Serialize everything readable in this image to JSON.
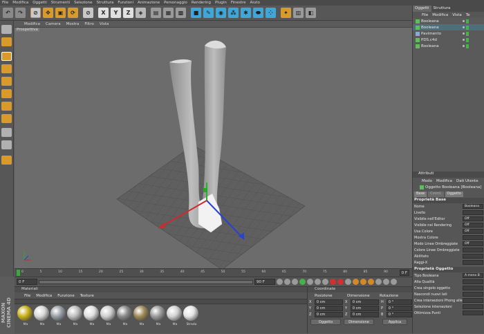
{
  "menubar": [
    "File",
    "Modifica",
    "Oggetti",
    "Strumenti",
    "Selezione",
    "Struttura",
    "Funzioni",
    "Animazione",
    "Personaggio",
    "Rendering",
    "Plugin",
    "Finestre",
    "Aiuto"
  ],
  "viewport": {
    "menu": [
      "Modifica",
      "Camera",
      "Mostra",
      "Filtro",
      "Vista"
    ],
    "label": "Prospettiva"
  },
  "timeline": {
    "ticks": [
      "0",
      "5",
      "10",
      "15",
      "20",
      "25",
      "30",
      "35",
      "40",
      "45",
      "50",
      "55",
      "60",
      "65",
      "70",
      "75",
      "80",
      "85",
      "90"
    ],
    "end": "0 F"
  },
  "transport": {
    "start": "0 F",
    "end": "90 F"
  },
  "materials": {
    "title": "Materiali",
    "menu": [
      "File",
      "Modifica",
      "Funzione",
      "Texture"
    ],
    "items": [
      {
        "label": "Ma",
        "color": "#c9b21e"
      },
      {
        "label": "Ma",
        "color": "#d8d8d8"
      },
      {
        "label": "Ma",
        "color": "#9aa0a8"
      },
      {
        "label": "Ma",
        "color": "#bfbfbf"
      },
      {
        "label": "Ma",
        "color": "#e0e0e0"
      },
      {
        "label": "Ma",
        "color": "#cfcfcf"
      },
      {
        "label": "Ma",
        "color": "#8a8a8a"
      },
      {
        "label": "Ma",
        "color": "#a08c5a"
      },
      {
        "label": "Ma",
        "color": "#9c9c9c"
      },
      {
        "label": "Ma",
        "color": "#d2d2d2"
      },
      {
        "label": "Strada",
        "color": "#e4e4e4"
      }
    ]
  },
  "coords": {
    "title": "Coordinate",
    "headers": [
      "Posizione",
      "Dimensione",
      "Rotazione"
    ],
    "rows": [
      {
        "axis": "X",
        "pos": "0 cm",
        "dim": "0 cm",
        "rot": "H",
        "rotv": "0 °"
      },
      {
        "axis": "Y",
        "pos": "0 cm",
        "dim": "0 cm",
        "rot": "P",
        "rotv": "0 °"
      },
      {
        "axis": "Z",
        "pos": "0 cm",
        "dim": "0 cm",
        "rot": "B",
        "rotv": "0 °"
      }
    ],
    "mode1": "Oggetto",
    "mode2": "Dimensione",
    "apply": "Applica"
  },
  "objects": {
    "tabs": [
      "Oggetti",
      "Struttura"
    ],
    "menu": [
      "File",
      "Modifica",
      "Vista",
      "Te"
    ],
    "items": [
      {
        "name": "Booleana",
        "selected": false
      },
      {
        "name": "Booleana",
        "selected": true
      },
      {
        "name": "Pavimento",
        "selected": false
      },
      {
        "name": "PDS.c4d",
        "selected": false
      },
      {
        "name": "Booleana",
        "selected": false
      }
    ]
  },
  "attributes": {
    "title": "Attributi",
    "menu": [
      "Modo",
      "Modifica",
      "Dati Utente"
    ],
    "objtitle": "Oggetto Booleana [Booleana]",
    "tabs": [
      "Base",
      "Coord.",
      "Oggetto"
    ],
    "base_section": "Proprietà Base",
    "base": [
      {
        "label": "Nome",
        "value": "Booleana"
      },
      {
        "label": "Livello",
        "value": ""
      },
      {
        "label": "Visibile nell'Editor",
        "value": "Off"
      },
      {
        "label": "Visibile nel Rendering",
        "value": "Off"
      },
      {
        "label": "Usa Colore",
        "value": "Off"
      },
      {
        "label": "Mostra Colore",
        "value": ""
      },
      {
        "label": "Modo Linee Ombreggiate",
        "value": "Off"
      },
      {
        "label": "Colore Linee Ombreggiate",
        "value": ""
      },
      {
        "label": "Abilitato",
        "value": ""
      },
      {
        "label": "Raggi-X",
        "value": ""
      }
    ],
    "obj_section": "Proprietà Oggetto",
    "obj": [
      {
        "label": "Tipo Booleana",
        "value": "A meno B"
      },
      {
        "label": "Alta Qualità",
        "value": ""
      },
      {
        "label": "Crea singolo oggetto",
        "value": ""
      },
      {
        "label": "Nascondi nuovi lati",
        "value": ""
      },
      {
        "label": "Crea intersezioni Phong alle intersezioni",
        "value": ""
      },
      {
        "label": "Selezione intersezioni",
        "value": ""
      },
      {
        "label": "Ottimizza Punti",
        "value": ""
      }
    ]
  },
  "side_brand": "MAXON CINEMA 4D"
}
